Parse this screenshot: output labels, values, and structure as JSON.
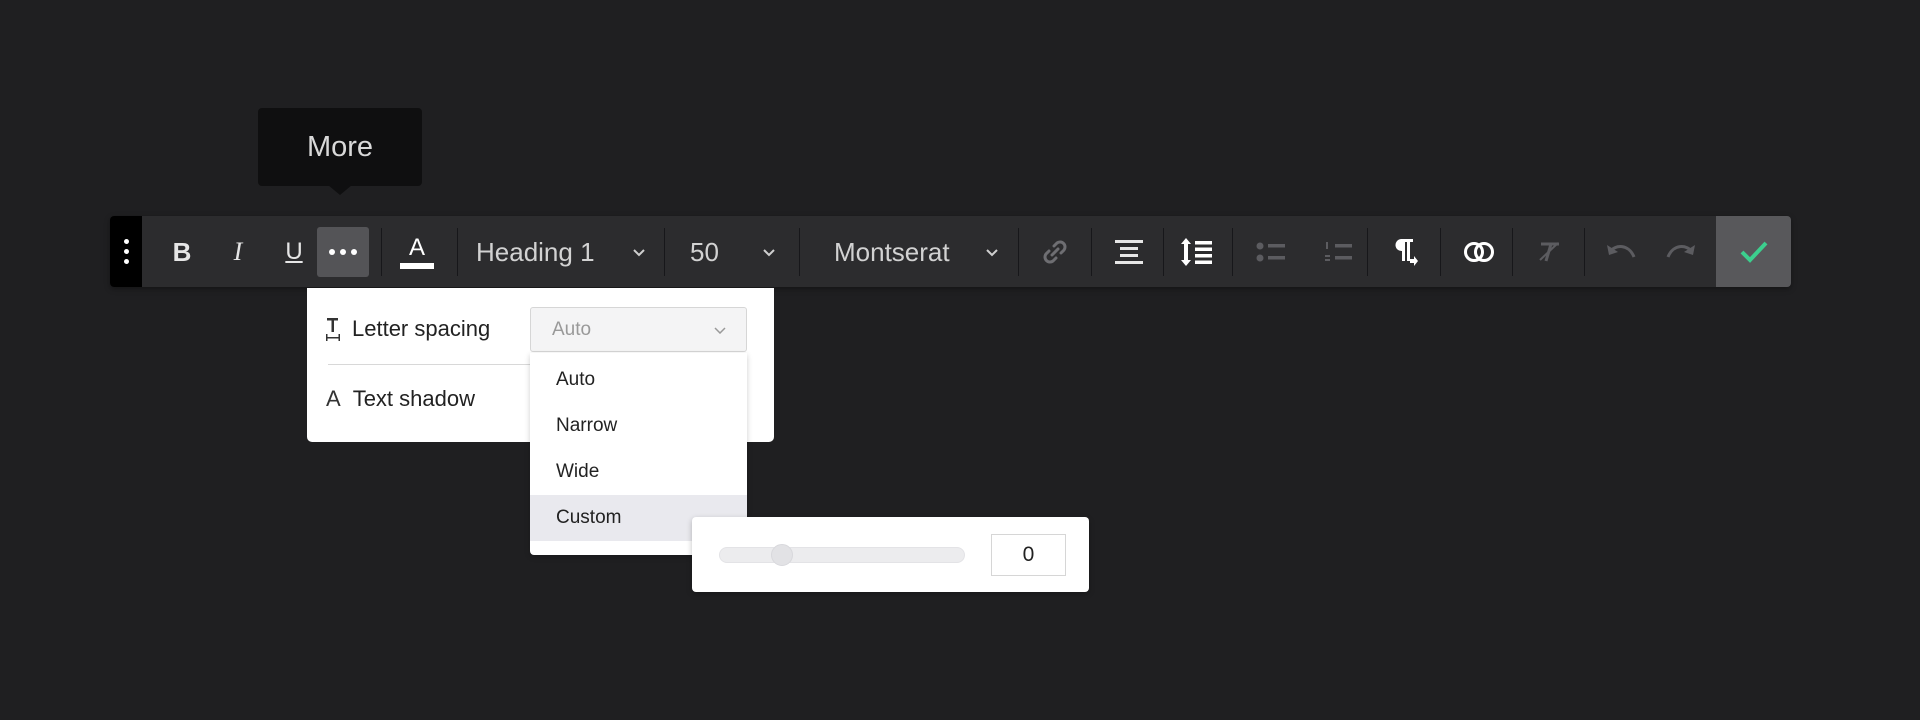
{
  "tooltip": {
    "text": "More"
  },
  "toolbar": {
    "bold_label": "B",
    "italic_label": "I",
    "underline_label": "U",
    "text_color_label": "A",
    "paragraph_style": "Heading 1",
    "font_size": "50",
    "font_family": "Montserat"
  },
  "panel": {
    "letter_spacing_label": "Letter spacing",
    "text_shadow_label": "Text shadow",
    "text_shadow_icon_label": "A",
    "letter_spacing_value": "Auto"
  },
  "letter_spacing_options": [
    "Auto",
    "Narrow",
    "Wide",
    "Custom"
  ],
  "custom_spacing": {
    "value": "0"
  },
  "colors": {
    "background": "#1f1f21",
    "toolbar": "#2c2c2e",
    "active_button": "#545457",
    "confirm_check": "#3ccf8e"
  }
}
